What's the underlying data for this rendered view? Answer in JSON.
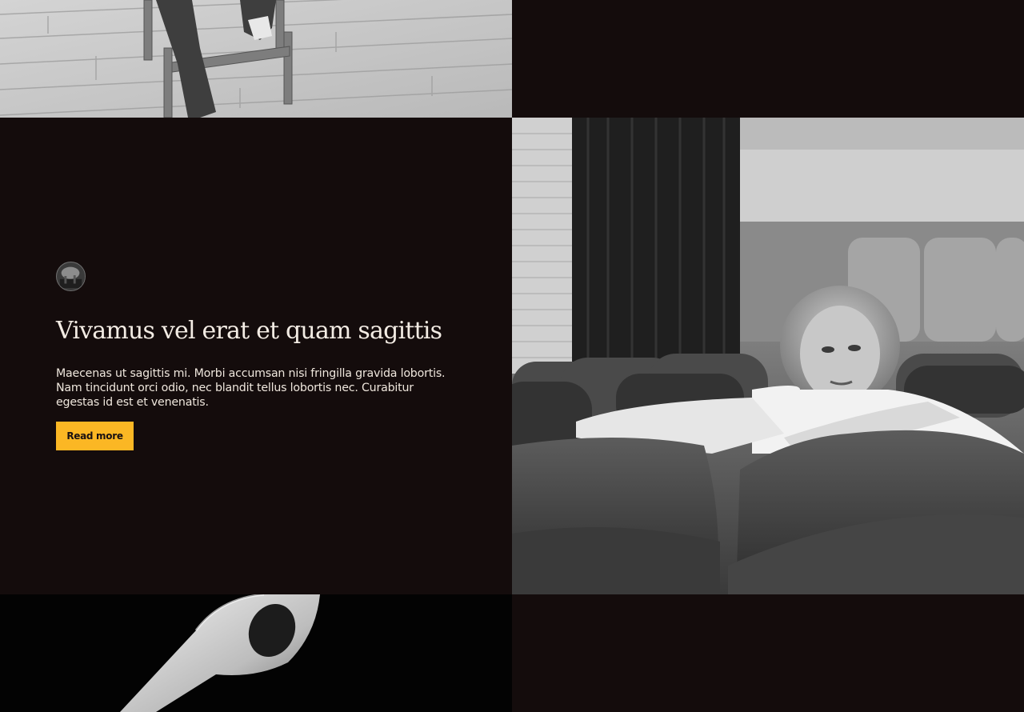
{
  "post": {
    "title": "Vivamus vel erat et quam sagittis",
    "excerpt": "Maecenas ut sagittis mi. Morbi accumsan nisi fringilla gravida lobortis. Nam tincidunt orci odio, nec blandit tellus lobortis nec. Curabitur egestas id est et venenatis.",
    "read_more_label": "Read more"
  },
  "colors": {
    "background": "#140c0c",
    "accent": "#fbb724",
    "text": "#f3ece4"
  }
}
